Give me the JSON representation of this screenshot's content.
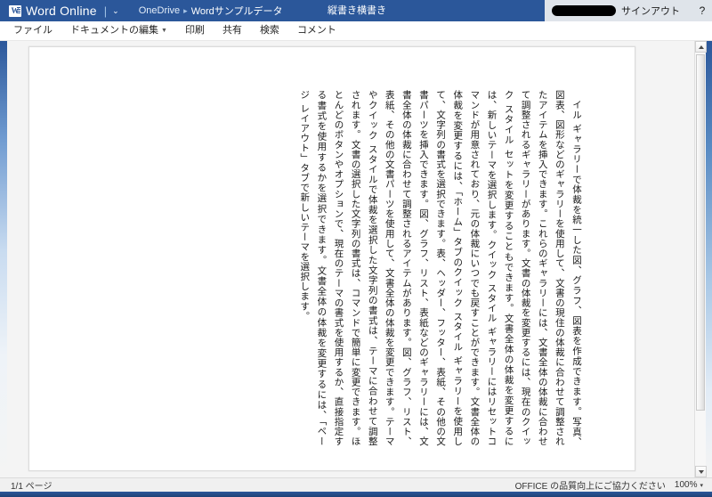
{
  "brand": {
    "logo_letter": "W",
    "name": "Word Online",
    "divider": "|",
    "caret": "⌄"
  },
  "breadcrumb": {
    "root": "OneDrive",
    "separator": "▸",
    "current": "Wordサンプルデータ"
  },
  "header": {
    "document_title": "縦書き横書き",
    "signout_label": "サインアウト",
    "help_label": "?"
  },
  "menu": {
    "items": [
      {
        "label": "ファイル",
        "has_caret": false
      },
      {
        "label": "ドキュメントの編集",
        "has_caret": true
      },
      {
        "label": "印刷",
        "has_caret": false
      },
      {
        "label": "共有",
        "has_caret": false
      },
      {
        "label": "検索",
        "has_caret": false
      },
      {
        "label": "コメント",
        "has_caret": false
      }
    ]
  },
  "document": {
    "writing_mode": "vertical-rl",
    "body_text": "イル ギャラリーで体裁を統一した図、グラフ、図表を作成できます。写真、図表、図形などのギャラリーを使用して、文書の現住の体裁に合わせて調整されたアイテムを挿入できます。これらのギャラリーには、文書全体の体裁に合わせて調整されるギャラリーがあります。文書の体裁を変更するには、現在のクイック スタイル セットを変更することもできます。文書全体の体裁を変更するには、新しいテーマを選択します。クイック スタイル ギャラリーにはリセットコマンドが用意されており、元の体裁にいつでも戻すことができます。文書全体の体裁を変更するには、「ホーム」タブのクイック スタイル ギャラリーを使用して、文字列の書式を選択できます。表、ヘッダー、フッター、表紙、その他の文書パーツを挿入できます。図、グラフ、リスト、表紙などのギャラリーには、文書全体の体裁に合わせて調整されるアイテムがあります。図、グラフ、リスト、表紙、その他の文書パーツを使用して、文書全体の体裁を変更できます。テーマやクイック スタイルで体裁を選択した文字列の書式は、テーマに合わせて調整されます。文書の選択した文字列の書式は、コマンドで簡単に変更できます。ほとんどのボタンやオプションで、現在のテーマの書式を使用するか、直接指定する書式を使用するかを選択できます。文書全体の体裁を変更するには、「ページ レイアウト」タブで新しいテーマを選択します。"
  },
  "scrollbar": {
    "up_arrow": "scroll-up-icon",
    "down_arrow": "scroll-down-icon"
  },
  "status": {
    "page_indicator": "1/1 ページ",
    "feedback_text": "OFFICE の品質向上にご協力ください",
    "zoom_level": "100%",
    "zoom_caret": "▾"
  },
  "colors": {
    "brand_blue": "#2b579a",
    "window_frame": "#1e4d8c",
    "canvas_bg": "#f4f4f4",
    "page_white": "#ffffff",
    "status_bg": "#f0f0f0"
  }
}
